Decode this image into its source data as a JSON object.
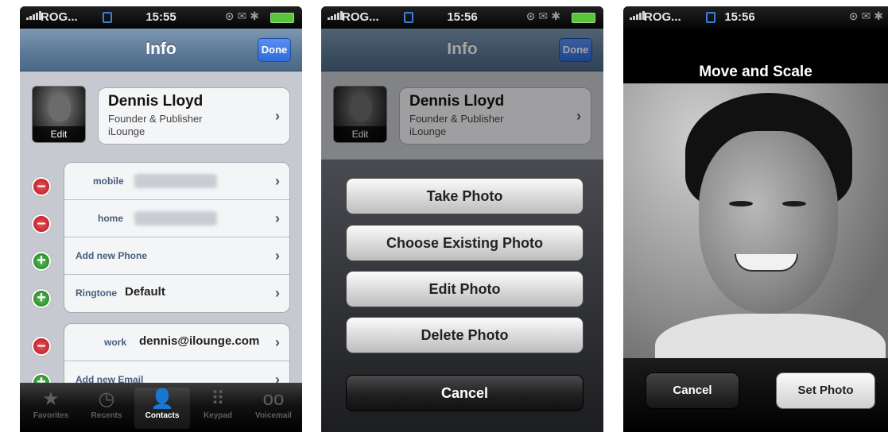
{
  "status": {
    "carrier": "ROG...",
    "panels_time": [
      "15:55",
      "15:56",
      "15:56"
    ]
  },
  "panel1": {
    "nav": {
      "title": "Info",
      "done_label": "Done"
    },
    "contact": {
      "photo_edit_label": "Edit",
      "name": "Dennis Lloyd",
      "title": "Founder & Publisher",
      "company": "iLounge"
    },
    "phones": [
      {
        "label": "mobile"
      },
      {
        "label": "home"
      },
      {
        "label": "Add new Phone"
      },
      {
        "label": "Ringtone",
        "value": "Default"
      }
    ],
    "emails": [
      {
        "label": "work",
        "value": "dennis@ilounge.com"
      },
      {
        "label": "Add new Email"
      }
    ],
    "tabs": [
      "Favorites",
      "Recents",
      "Contacts",
      "Keypad",
      "Voicemail"
    ]
  },
  "panel2": {
    "actions": [
      "Take Photo",
      "Choose Existing Photo",
      "Edit Photo",
      "Delete Photo"
    ],
    "cancel_label": "Cancel"
  },
  "panel3": {
    "title": "Move and Scale",
    "cancel_label": "Cancel",
    "set_label": "Set Photo"
  }
}
